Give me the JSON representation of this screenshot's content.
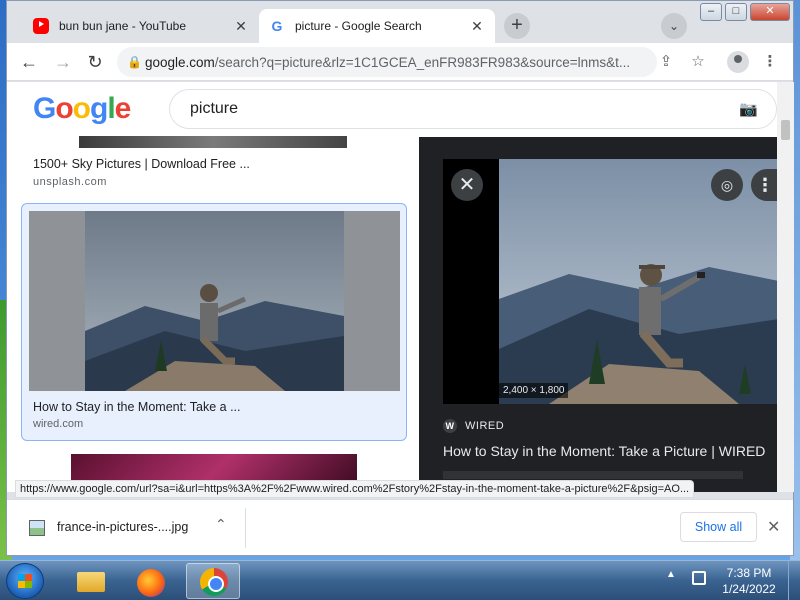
{
  "browser": {
    "tabs": [
      {
        "title": "bun bun jane - YouTube",
        "favicon": "youtube-icon"
      },
      {
        "title": "picture - Google Search",
        "favicon": "google-icon"
      }
    ],
    "new_tab": "+",
    "url_host": "google.com",
    "url_rest": "/search?q=picture&rlz=1C1GCEA_enFR983FR983&source=lnms&t..."
  },
  "search": {
    "logo": {
      "G": "G",
      "o1": "o",
      "o2": "o",
      "g": "g",
      "l": "l",
      "e": "e"
    },
    "query": "picture"
  },
  "results": [
    {
      "title": "1500+ Sky Pictures | Download Free ...",
      "source": "unsplash.com"
    },
    {
      "title": "How to Stay in the Moment: Take a ...",
      "source": "wired.com"
    }
  ],
  "side_panel": {
    "dimensions": "2,400 × 1,800",
    "source": "WIRED",
    "source_badge": "W",
    "title": "How to Stay in the Moment: Take a Picture | WIRED"
  },
  "status_url": "https://www.google.com/url?sa=i&url=https%3A%2F%2Fwww.wired.com%2Fstory%2Fstay-in-the-moment-take-a-picture%2F&psig=AO...",
  "downloads": {
    "file": "france-in-pictures-....jpg",
    "show_all": "Show all"
  },
  "taskbar": {
    "time": "7:38 PM",
    "date": "1/24/2022"
  },
  "colors": {
    "accent": "#1a73e8",
    "panel_bg": "#202124",
    "selected_card": "#e8f0fe"
  }
}
